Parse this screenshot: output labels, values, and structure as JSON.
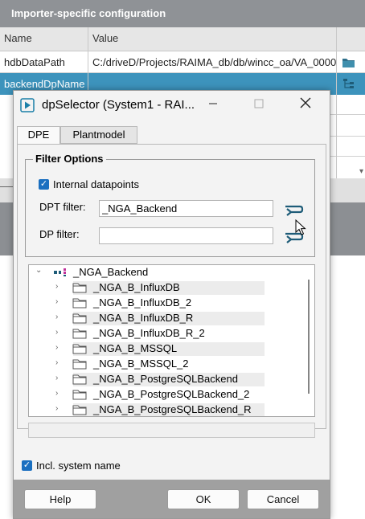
{
  "background": {
    "header_title": "Importer-specific configuration",
    "columns": [
      "Name",
      "Value"
    ],
    "rows": [
      {
        "name": "hdbDataPath",
        "value": "C:/driveD/Projects/RAIMA_db/db/wincc_oa/VA_0000"
      },
      {
        "name": "backendDpName",
        "value": ""
      }
    ]
  },
  "dialog": {
    "title": "dpSelector (System1 - RAI...",
    "tabs": [
      {
        "label": "DPE",
        "selected": true
      },
      {
        "label": "Plantmodel",
        "selected": false
      }
    ],
    "filter_options": {
      "group_title": "Filter Options",
      "internal_datapoints": {
        "label": "Internal datapoints",
        "checked": true
      },
      "dpt_filter": {
        "label": "DPT filter:",
        "value": "_NGA_Backend"
      },
      "dp_filter": {
        "label": "DP filter:",
        "value": ""
      }
    },
    "tree": {
      "root": "_NGA_Backend",
      "children": [
        "_NGA_B_InfluxDB",
        "_NGA_B_InfluxDB_2",
        "_NGA_B_InfluxDB_R",
        "_NGA_B_InfluxDB_R_2",
        "_NGA_B_MSSQL",
        "_NGA_B_MSSQL_2",
        "_NGA_B_PostgreSQLBackend",
        "_NGA_B_PostgreSQLBackend_2",
        "_NGA_B_PostgreSQLBackend_R"
      ]
    },
    "incl_system_name": {
      "label": "Incl. system name",
      "checked": true
    },
    "buttons": {
      "help": "Help",
      "ok": "OK",
      "cancel": "Cancel"
    },
    "icons": {
      "app": "play-icon",
      "minimize": "minimize-icon",
      "maximize": "maximize-icon",
      "close": "close-icon"
    }
  },
  "colors": {
    "header": "#8f9296",
    "selection": "#3d93bc",
    "checkbox": "#1a6fc0",
    "footer": "#a0a0a0"
  }
}
